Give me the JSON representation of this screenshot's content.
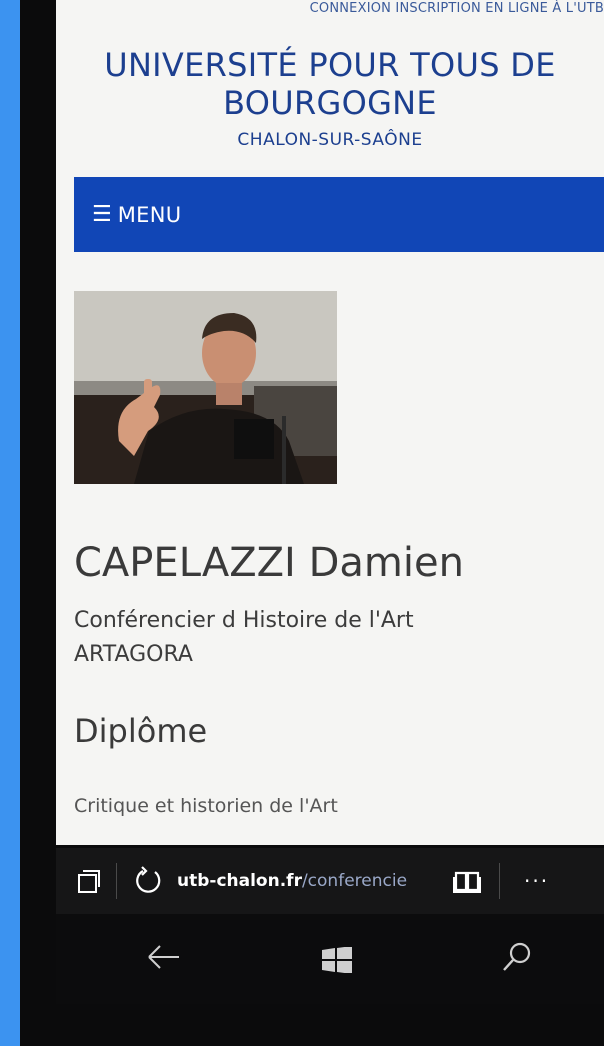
{
  "top_links": "CONNEXION   INSCRIPTION EN LIGNE À L'UTB",
  "site": {
    "title_line1": "UNIVERSITÉ POUR TOUS DE",
    "title_line2": "BOURGOGNE",
    "subtitle": "CHALON-SUR-SAÔNE"
  },
  "menu": {
    "icon": "hamburger-icon",
    "label": "MENU"
  },
  "profile": {
    "photo": "speaker-photo",
    "name": "CAPELAZZI Damien",
    "role_line1": "Conférencier d Histoire de l'Art",
    "role_line2": "ARTAGORA",
    "section_heading": "Diplôme",
    "section_text": "Critique et historien de l'Art"
  },
  "browser": {
    "url_host": "utb-chalon.fr",
    "url_path": "/conferencie",
    "icons": [
      "tabs-icon",
      "refresh-icon",
      "reading-view-icon",
      "more-icon"
    ],
    "more_label": "···"
  },
  "os_nav": {
    "icons": [
      "back-arrow-icon",
      "windows-start-icon",
      "search-icon"
    ]
  },
  "colors": {
    "background": "#3c93f0",
    "menu_bar": "#1146b6",
    "title": "#1c3f8f",
    "page_bg": "#f5f5f3"
  }
}
